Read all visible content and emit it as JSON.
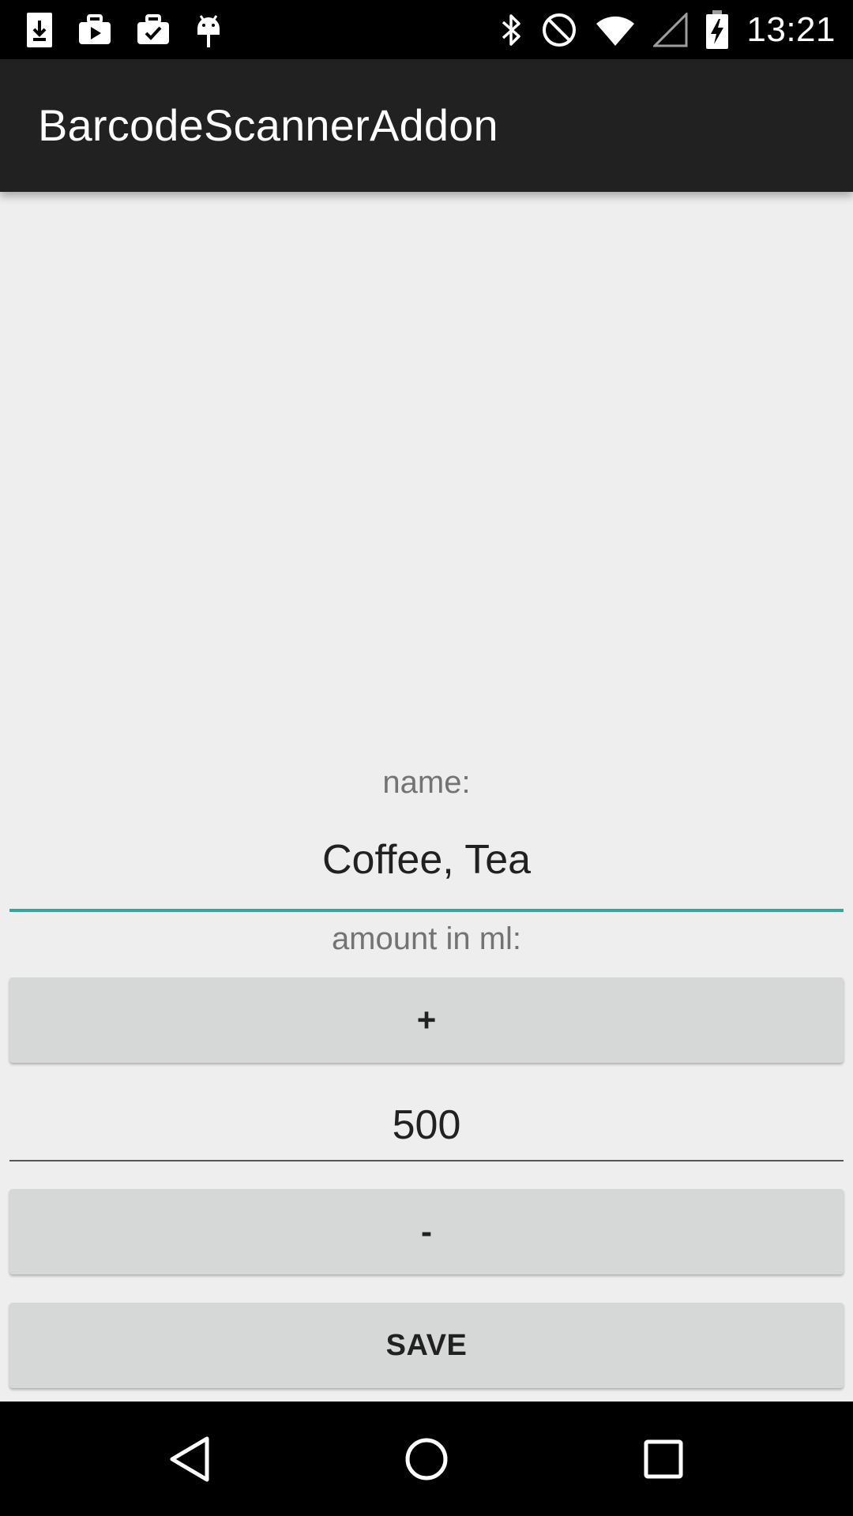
{
  "status_bar": {
    "time": "13:21",
    "left_icons": [
      "download-icon",
      "youtube-icon",
      "briefcase-check-icon",
      "android-icon"
    ],
    "right_icons": [
      "bluetooth-icon",
      "do-not-disturb-icon",
      "wifi-icon",
      "cellular-signal-icon",
      "battery-charging-icon"
    ]
  },
  "app_bar": {
    "title": "BarcodeScannerAddon"
  },
  "form": {
    "name_label": "name:",
    "name_value": "Coffee, Tea",
    "amount_label": "amount in ml:",
    "plus_label": "+",
    "amount_value": "500",
    "minus_label": "-",
    "save_label": "SAVE"
  },
  "nav_bar": {
    "buttons": [
      "back-icon",
      "home-icon",
      "recents-icon"
    ]
  },
  "colors": {
    "status_bar": "#000000",
    "app_bar": "#212121",
    "background": "#eeeeee",
    "accent_underline": "#3aa597",
    "button": "#d6d7d7"
  }
}
